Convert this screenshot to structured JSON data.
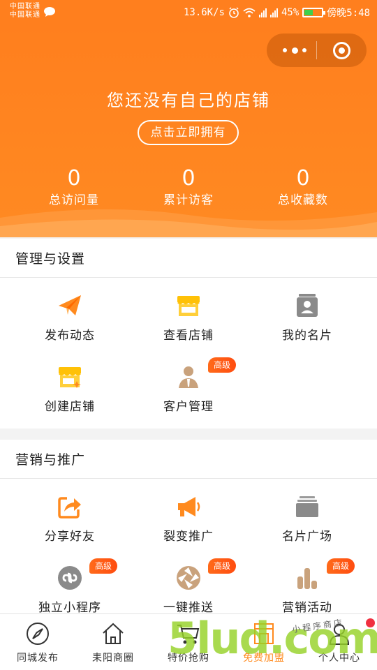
{
  "status_bar": {
    "carrier_1": "中国联通",
    "carrier_2": "中国联通",
    "speed": "13.6K/s",
    "battery": "45%",
    "time": "傍晚5:48"
  },
  "header": {
    "no_shop_text": "您还没有自己的店铺",
    "own_button": "点击立即拥有",
    "stats": [
      {
        "value": "0",
        "label": "总访问量"
      },
      {
        "value": "0",
        "label": "累计访客"
      },
      {
        "value": "0",
        "label": "总收藏数"
      }
    ]
  },
  "management": {
    "title": "管理与设置",
    "items": [
      {
        "label": "发布动态",
        "icon": "paper-plane-icon"
      },
      {
        "label": "查看店铺",
        "icon": "storefront-icon"
      },
      {
        "label": "我的名片",
        "icon": "contact-card-icon"
      },
      {
        "label": "创建店铺",
        "icon": "create-shop-icon"
      },
      {
        "label": "客户管理",
        "icon": "customer-icon",
        "badge": "高级"
      }
    ]
  },
  "marketing": {
    "title": "营销与推广",
    "items": [
      {
        "label": "分享好友",
        "icon": "share-icon"
      },
      {
        "label": "裂变推广",
        "icon": "megaphone-icon"
      },
      {
        "label": "名片广场",
        "icon": "card-stack-icon"
      },
      {
        "label": "独立小程序",
        "icon": "mini-program-icon",
        "badge": "高级"
      },
      {
        "label": "一键推送",
        "icon": "aperture-icon",
        "badge": "高级"
      },
      {
        "label": "营销活动",
        "icon": "bar-chart-icon",
        "badge": "高级"
      }
    ]
  },
  "tabbar": [
    {
      "label": "同城发布",
      "icon": "compass-icon"
    },
    {
      "label": "耒阳商圈",
      "icon": "home-icon"
    },
    {
      "label": "特价抢购",
      "icon": "cart-icon"
    },
    {
      "label": "免费加盟",
      "icon": "shop-icon"
    },
    {
      "label": "个人中心",
      "icon": "user-icon"
    }
  ],
  "watermark": {
    "main": "5lud.com",
    "small": "小程序商店"
  },
  "colors": {
    "primary": "#ff7f1e",
    "badge": "#ff5a14",
    "icon_orange": "#ff8a1e",
    "icon_yellow": "#ffc107",
    "icon_gray": "#8a8a8a"
  }
}
